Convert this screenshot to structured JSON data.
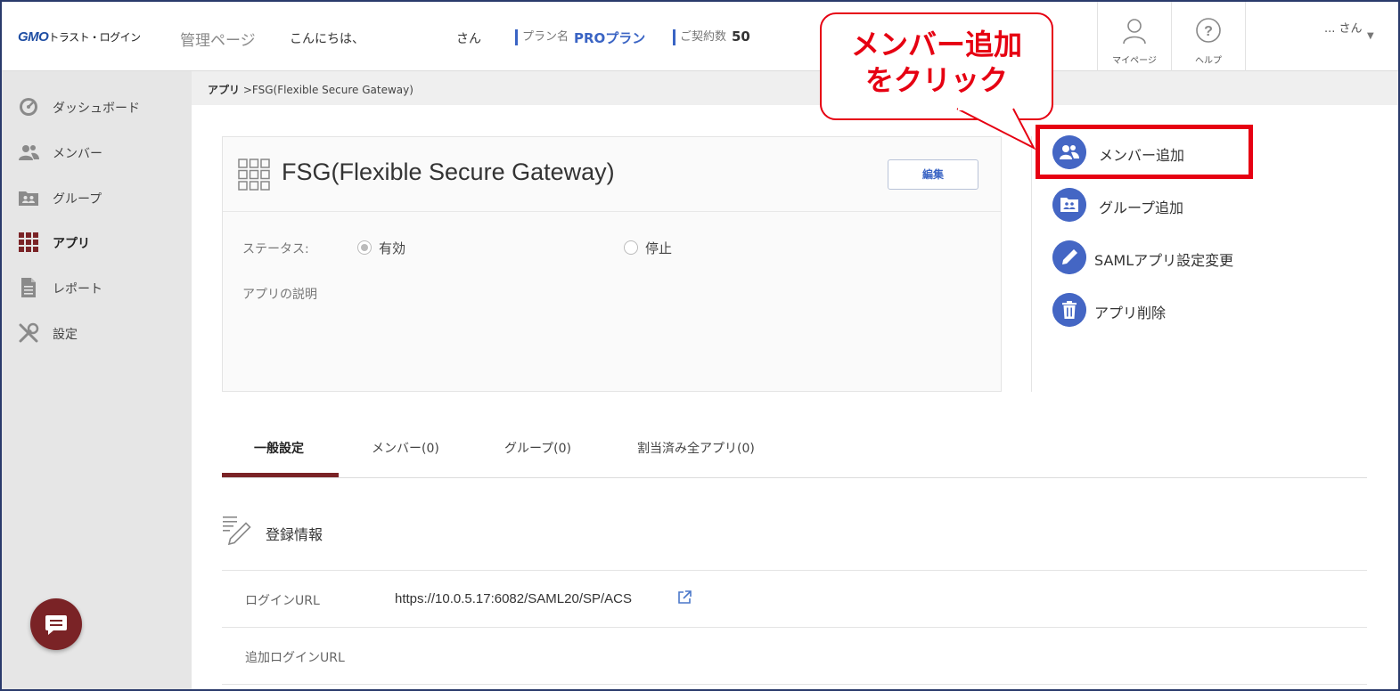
{
  "header": {
    "logo_gmo": "GMO",
    "logo_rest": "トラスト・ログイン",
    "page_kind": "管理ページ",
    "greeting": "こんにちは、",
    "san": "さん",
    "plan_label": "プラン名",
    "plan_value": "PROプラン",
    "contract_label": "ご契約数",
    "contract_value": "50",
    "mypage_label": "マイページ",
    "help_label": "ヘルプ",
    "user_name": "... さん"
  },
  "sidebar": {
    "items": [
      {
        "label": "ダッシュボード",
        "icon": "dashboard-icon"
      },
      {
        "label": "メンバー",
        "icon": "members-icon"
      },
      {
        "label": "グループ",
        "icon": "group-icon"
      },
      {
        "label": "アプリ",
        "icon": "apps-grid-icon",
        "active": true
      },
      {
        "label": "レポート",
        "icon": "report-icon"
      },
      {
        "label": "設定",
        "icon": "settings-tools-icon"
      }
    ]
  },
  "breadcrumb": {
    "root": "アプリ",
    "current": ">FSG(Flexible Secure Gateway)"
  },
  "app": {
    "title": "FSG(Flexible Secure Gateway)",
    "edit_label": "編集",
    "status_label": "ステータス:",
    "status_enabled": "有効",
    "status_disabled": "停止",
    "description_label": "アプリの説明"
  },
  "actions": {
    "add_member": "メンバー追加",
    "add_group": "グループ追加",
    "saml_change": "SAMLアプリ設定変更",
    "delete_app": "アプリ削除"
  },
  "callout": {
    "line1": "メンバー追加",
    "line2": "をクリック"
  },
  "tabs": [
    {
      "label": "一般設定",
      "active": true
    },
    {
      "label": "メンバー(0)"
    },
    {
      "label": "グループ(0)"
    },
    {
      "label": "割当済み全アプリ(0)"
    }
  ],
  "registration": {
    "section_title": "登録情報",
    "login_url_label": "ログインURL",
    "login_url_value": "https://10.0.5.17:6082/SAML20/SP/ACS",
    "additional_login_url_label": "追加ログインURL"
  },
  "colors": {
    "accent_blue": "#3a64c4",
    "brand_maroon": "#7a2326",
    "highlight_red": "#e60012"
  }
}
